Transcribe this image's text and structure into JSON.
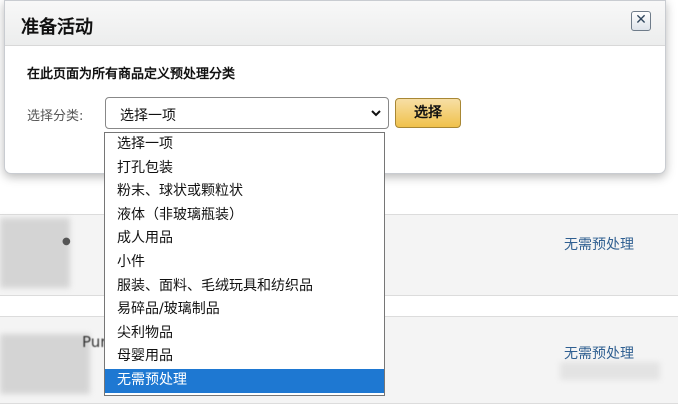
{
  "modal": {
    "title": "准备活动",
    "close_icon": "close-x-icon",
    "subtitle": "在此页面为所有商品定义预处理分类",
    "select_label": "选择分类:",
    "select_value": "选择一项",
    "choose_button": "选择"
  },
  "dropdown": {
    "options": [
      "选择一项",
      "打孔包装",
      "粉末、球状或颗粒状",
      "液体（非玻璃瓶装）",
      "成人用品",
      "小件",
      "服装、面料、毛绒玩具和纺织品",
      "易碎品/玻璃制品",
      "尖利物品",
      "母婴用品",
      "无需预处理"
    ],
    "highlighted": "无需预处理"
  },
  "background": {
    "row1_status": "无需预处理",
    "row2_status": "无需预处理",
    "row2_partial_text": "Pur"
  },
  "colors": {
    "highlight": "#1e78d2",
    "button_gold": "#f0c14b",
    "link_blue": "#2f5f91"
  }
}
